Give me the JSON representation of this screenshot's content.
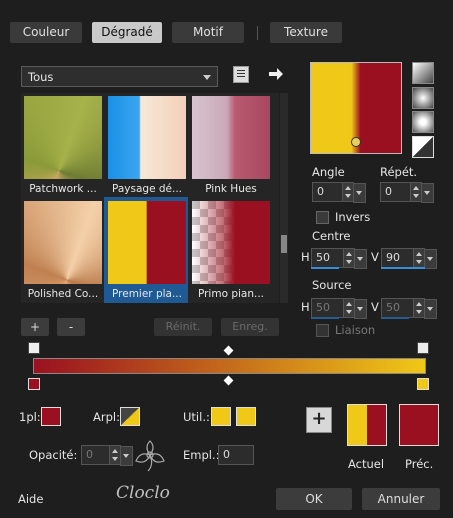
{
  "tabs": [
    "Couleur",
    "Dégradé",
    "Motif",
    "Texture"
  ],
  "category": "Tous",
  "thumbnails": [
    {
      "label": "Patchwork ..."
    },
    {
      "label": "Paysage dé..."
    },
    {
      "label": "Pink Hues"
    },
    {
      "label": "Polished Co..."
    },
    {
      "label": "Premier pla..."
    },
    {
      "label": "Primo pian..."
    }
  ],
  "buttons": {
    "plus": "+",
    "minus": "-",
    "reinit": "Réinit.",
    "enreg": "Enreg.",
    "ok": "OK",
    "annuler": "Annuler",
    "aide": "Aide",
    "add": "+"
  },
  "angle": {
    "label": "Angle",
    "value": "0"
  },
  "repet": {
    "label": "Répét.",
    "value": "0"
  },
  "invers": "Invers",
  "centre": {
    "label": "Centre",
    "h": "50",
    "v": "90"
  },
  "source": {
    "label": "Source",
    "h": "50",
    "v": "50"
  },
  "liaison": "Liaison",
  "hv": {
    "h": "H",
    "v": "V"
  },
  "bottom": {
    "premier": "1pl:",
    "arrier": "Arpl:",
    "util": "Util.:",
    "opacite": "Opacité:",
    "opacite_value": "0",
    "empl": "Empl.:",
    "empl_value": "0",
    "actuel": "Actuel",
    "prec": "Préc."
  },
  "watermark": "Cloclo",
  "colors": {
    "red": "#9a1020",
    "yellow": "#f0c817",
    "accent": "#3a8bd8"
  }
}
